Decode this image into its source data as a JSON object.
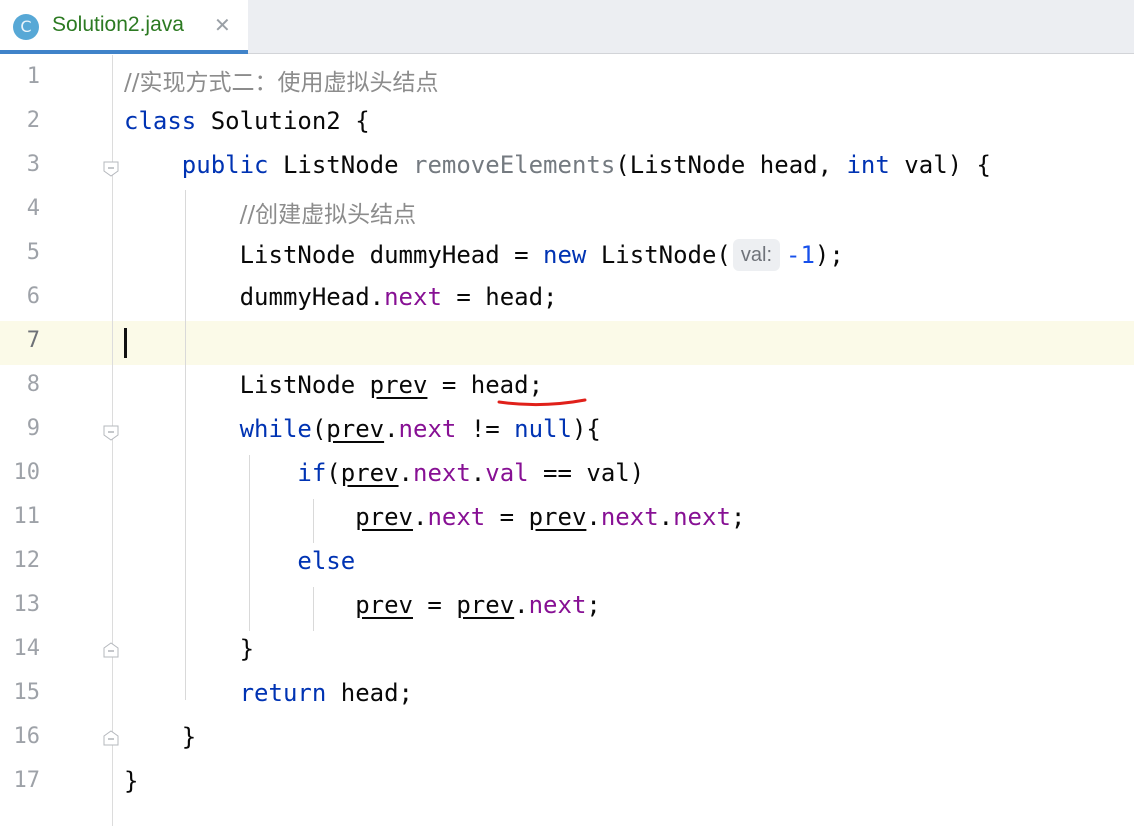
{
  "tab": {
    "icon_letter": "C",
    "title": "Solution2.java",
    "close_glyph": "✕"
  },
  "editor": {
    "current_line": 7,
    "line_numbers": [
      "1",
      "2",
      "3",
      "4",
      "5",
      "6",
      "7",
      "8",
      "9",
      "10",
      "11",
      "12",
      "13",
      "14",
      "15",
      "16",
      "17"
    ],
    "lines": [
      [
        {
          "t": "//实现方式二：使用虚拟头结点",
          "k": "cm"
        }
      ],
      [
        {
          "t": "class",
          "k": "kw"
        },
        {
          "t": " Solution2 {"
        }
      ],
      [
        {
          "t": "    "
        },
        {
          "t": "public",
          "k": "kw"
        },
        {
          "t": " ListNode "
        },
        {
          "t": "removeElements",
          "k": "fn"
        },
        {
          "t": "(ListNode head, "
        },
        {
          "t": "int",
          "k": "kw"
        },
        {
          "t": " val) {"
        }
      ],
      [
        {
          "t": "        "
        },
        {
          "t": "//创建虚拟头结点",
          "k": "cm"
        }
      ],
      [
        {
          "t": "        ListNode dummyHead = "
        },
        {
          "t": "new",
          "k": "kw"
        },
        {
          "t": " ListNode("
        },
        {
          "t": "val:",
          "k": "hint"
        },
        {
          "t": "-1",
          "k": "num"
        },
        {
          "t": ");"
        }
      ],
      [
        {
          "t": "        dummyHead."
        },
        {
          "t": "next",
          "k": "fld"
        },
        {
          "t": " = head;"
        }
      ],
      [],
      [
        {
          "t": "        ListNode "
        },
        {
          "t": "prev",
          "k": "ul"
        },
        {
          "t": " = head;"
        }
      ],
      [
        {
          "t": "        "
        },
        {
          "t": "while",
          "k": "kw"
        },
        {
          "t": "("
        },
        {
          "t": "prev",
          "k": "ul"
        },
        {
          "t": "."
        },
        {
          "t": "next",
          "k": "fld"
        },
        {
          "t": " != "
        },
        {
          "t": "null",
          "k": "kw"
        },
        {
          "t": "){"
        }
      ],
      [
        {
          "t": "            "
        },
        {
          "t": "if",
          "k": "kw"
        },
        {
          "t": "("
        },
        {
          "t": "prev",
          "k": "ul"
        },
        {
          "t": "."
        },
        {
          "t": "next",
          "k": "fld"
        },
        {
          "t": "."
        },
        {
          "t": "val",
          "k": "fld"
        },
        {
          "t": " == val)"
        }
      ],
      [
        {
          "t": "                "
        },
        {
          "t": "prev",
          "k": "ul"
        },
        {
          "t": "."
        },
        {
          "t": "next",
          "k": "fld"
        },
        {
          "t": " = "
        },
        {
          "t": "prev",
          "k": "ul"
        },
        {
          "t": "."
        },
        {
          "t": "next",
          "k": "fld"
        },
        {
          "t": "."
        },
        {
          "t": "next",
          "k": "fld"
        },
        {
          "t": ";"
        }
      ],
      [
        {
          "t": "            "
        },
        {
          "t": "else",
          "k": "kw"
        }
      ],
      [
        {
          "t": "                "
        },
        {
          "t": "prev",
          "k": "ul"
        },
        {
          "t": " = "
        },
        {
          "t": "prev",
          "k": "ul"
        },
        {
          "t": "."
        },
        {
          "t": "next",
          "k": "fld"
        },
        {
          "t": ";"
        }
      ],
      [
        {
          "t": "        }"
        }
      ],
      [
        {
          "t": "        "
        },
        {
          "t": "return",
          "k": "kw"
        },
        {
          "t": " head;"
        }
      ],
      [
        {
          "t": "    }"
        }
      ],
      [
        {
          "t": "}"
        }
      ]
    ]
  },
  "colors": {
    "keyword": "#0033b3",
    "field": "#871094",
    "method": "#747a80",
    "number": "#1750eb",
    "comment": "#8c8c8c",
    "current_line_bg": "#fbfae8",
    "tab_underline": "#4083c9",
    "squiggle": "#e0201a"
  }
}
